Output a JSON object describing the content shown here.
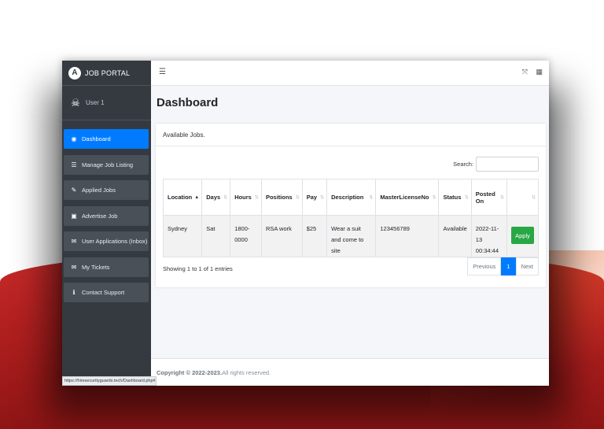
{
  "app": {
    "brand": "JOB PORTAL",
    "brand_logo": "A",
    "user": "User 1"
  },
  "sidebar": {
    "items": [
      {
        "label": "Dashboard",
        "icon": "dashboard-icon",
        "active": true
      },
      {
        "label": "Manage Job Listing",
        "icon": "list-icon"
      },
      {
        "label": "Applied Jobs",
        "icon": "edit-icon"
      },
      {
        "label": "Advertise Job",
        "icon": "ad-icon"
      },
      {
        "label": "User Applications (Inbox)",
        "icon": "envelope-icon"
      },
      {
        "label": "My Tickets",
        "icon": "envelope-icon"
      },
      {
        "label": "Contact Support",
        "icon": "info-icon"
      }
    ]
  },
  "status_url": "https://hiresecurityguards.tech/Dashboard.php#",
  "main": {
    "title": "Dashboard",
    "card_title": "Available Jobs.",
    "search_label": "Search:",
    "table": {
      "columns": [
        "Location",
        "Days",
        "Hours",
        "Positions",
        "Pay",
        "Description",
        "MasterLicenseNo",
        "Status",
        "Posted On",
        ""
      ],
      "rows": [
        {
          "location": "Sydney",
          "days": "Sat",
          "hours": "1800-0000",
          "positions": "RSA work",
          "pay": "$25",
          "description": "Wear a suit and come to site",
          "license": "123456789",
          "status": "Available",
          "posted_on": "2022-11-13 00:34:44",
          "action": "Apply"
        }
      ]
    },
    "info": "Showing 1 to 1 of 1 entries",
    "pagination": {
      "previous": "Previous",
      "current": "1",
      "next": "Next"
    }
  },
  "footer": {
    "copyright": "Copyright © 2022-2023.",
    "rights": " All rights reserved."
  },
  "colors": {
    "sidebar": "#343a40",
    "accent": "#007bff",
    "apply": "#28a745"
  }
}
